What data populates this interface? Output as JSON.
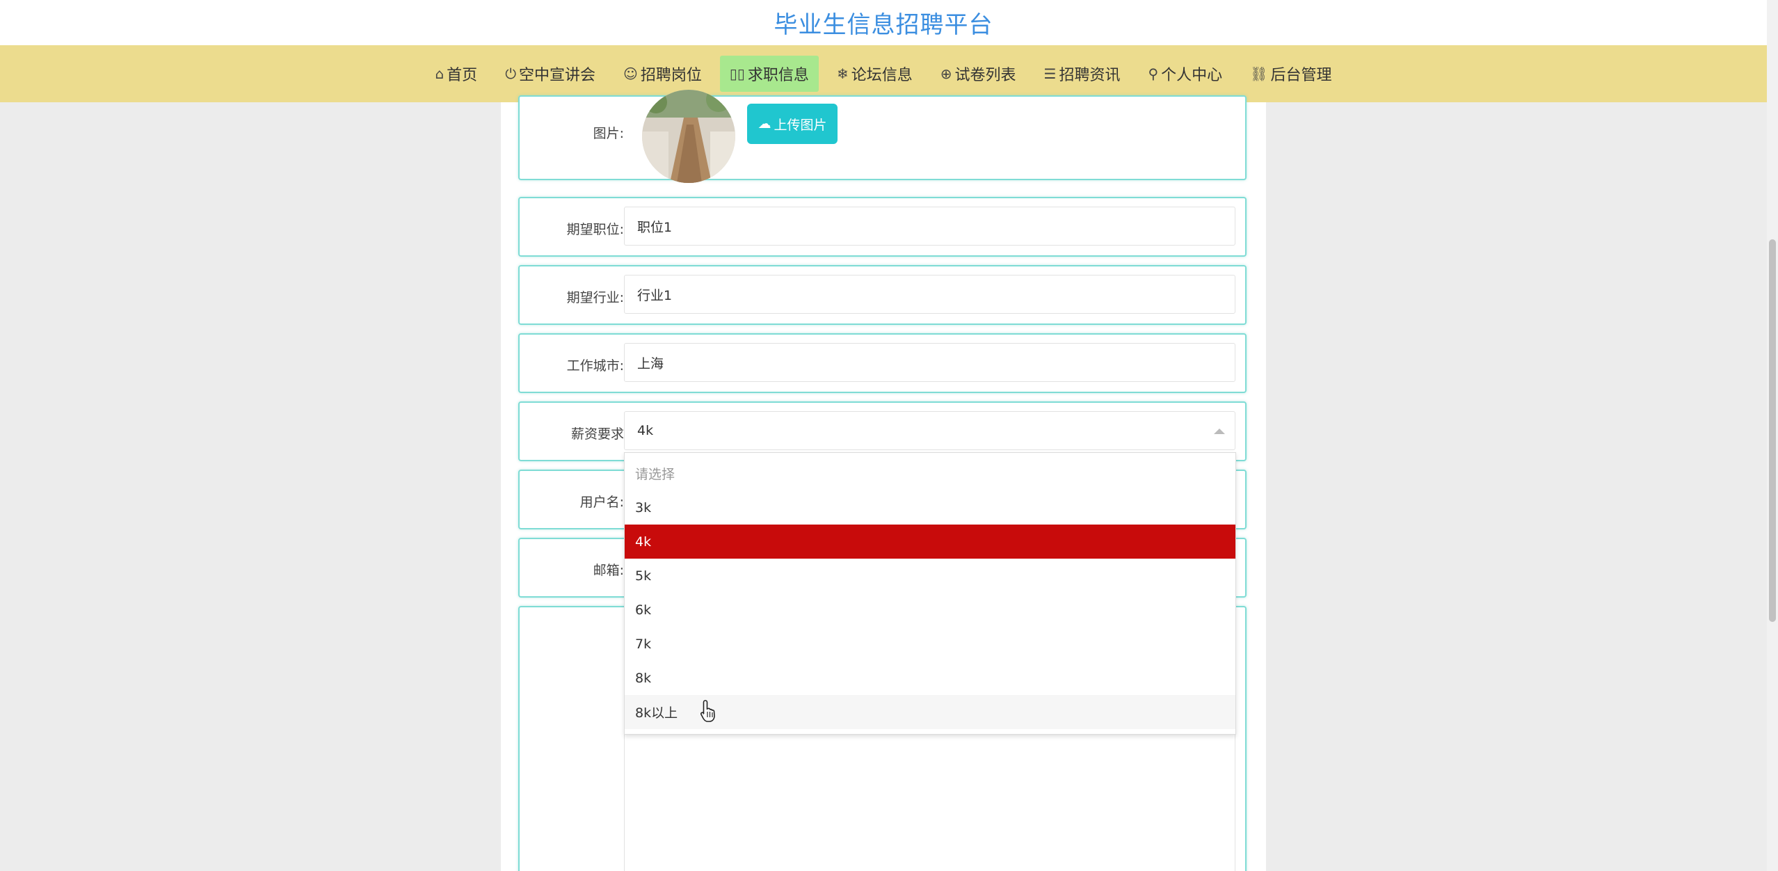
{
  "site": {
    "title": "毕业生信息招聘平台"
  },
  "nav": {
    "items": [
      {
        "label": "首页",
        "icon": "home-icon",
        "glyph": "⌂"
      },
      {
        "label": "空中宣讲会",
        "icon": "power-icon",
        "glyph": "⏻"
      },
      {
        "label": "招聘岗位",
        "icon": "smile-icon",
        "glyph": "☺"
      },
      {
        "label": "求职信息",
        "icon": "missing-glyph-icon",
        "glyph": "▯▯",
        "active": true
      },
      {
        "label": "论坛信息",
        "icon": "snowflake-icon",
        "glyph": "❄"
      },
      {
        "label": "试卷列表",
        "icon": "globe-icon",
        "glyph": "⊕"
      },
      {
        "label": "招聘资讯",
        "icon": "sliders-icon",
        "glyph": "☰"
      },
      {
        "label": "个人中心",
        "icon": "user-icon",
        "glyph": "⚲"
      },
      {
        "label": "后台管理",
        "icon": "link-icon",
        "glyph": "⛓"
      }
    ]
  },
  "form": {
    "image": {
      "label": "图片:",
      "upload_label": "上传图片"
    },
    "position": {
      "label": "期望职位:",
      "value": "职位1"
    },
    "industry": {
      "label": "期望行业:",
      "value": "行业1"
    },
    "city": {
      "label": "工作城市:",
      "value": "上海"
    },
    "salary": {
      "label": "薪资要求",
      "value": "4k",
      "options": [
        "请选择",
        "3k",
        "4k",
        "5k",
        "6k",
        "7k",
        "8k",
        "8k以上"
      ],
      "selected_index": 2,
      "hover_index": 7
    },
    "username": {
      "label": "用户名:"
    },
    "email": {
      "label": "邮箱:"
    }
  },
  "colors": {
    "nav_bg": "#ecdc8e",
    "nav_active": "#a8e88e",
    "title": "#3b8ee0",
    "upload_button": "#20c6cf",
    "selected_option": "#c80b0b",
    "row_border": "#7fdcd5"
  }
}
